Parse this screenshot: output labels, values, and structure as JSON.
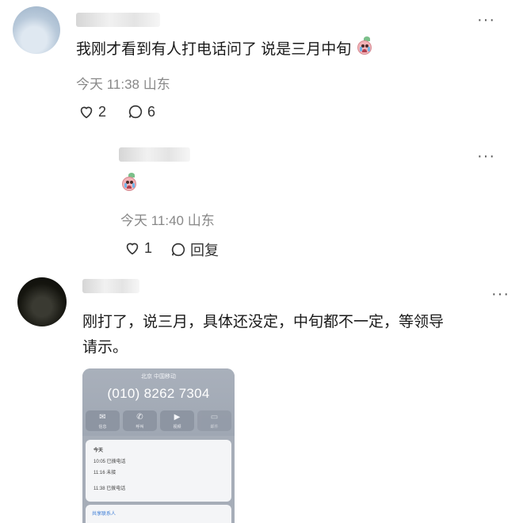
{
  "comments": [
    {
      "text": "我刚才看到有人打电话问了 说是三月中旬",
      "emoji": "crying-clown-emoji",
      "time": "今天 11:38",
      "location": "山东",
      "likes": "2",
      "replies": "6"
    },
    {
      "emoji": "crying-clown-emoji",
      "time": "今天 11:40",
      "location": "山东",
      "likes": "1",
      "reply_label": "回复"
    },
    {
      "text_line1": "刚打了，说三月，具体还没定，中旬都不一定，等领导",
      "text_line2": "请示。"
    }
  ],
  "more_label": "···",
  "phone_screenshot": {
    "carrier": "北京 中国移动",
    "number": "(010) 8262 7304",
    "buttons": [
      {
        "icon": "message-icon",
        "glyph": "✉",
        "label": "信息"
      },
      {
        "icon": "phone-icon",
        "glyph": "✆",
        "label": "呼叫"
      },
      {
        "icon": "video-icon",
        "glyph": "▶",
        "label": "视频"
      },
      {
        "icon": "mail-icon",
        "glyph": "▭",
        "label": "邮件"
      }
    ],
    "card_title": "今天",
    "calls": [
      "10:05 已拨电话",
      "11:16 未接",
      "11:38 已拨电话"
    ],
    "card_link": "共享联系人"
  },
  "colors": {
    "text": "#1a1a1a",
    "meta": "#888888",
    "link": "#3a7bd5"
  }
}
